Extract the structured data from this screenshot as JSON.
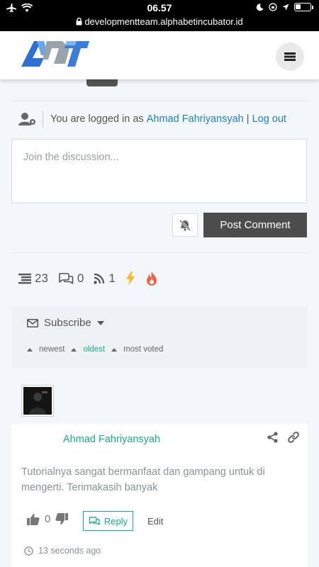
{
  "status_bar": {
    "time": "06.57",
    "url": "developmentteam.alphabetincubator.id"
  },
  "header": {
    "logo_text": "ADT",
    "menu_icon": "hamburger-icon"
  },
  "login": {
    "prefix": "You are logged in as",
    "user_name": "Ahmad Fahriyansyah",
    "separator": "|",
    "logout_label": "Log out"
  },
  "comment_form": {
    "placeholder": "Join the discussion...",
    "post_label": "Post Comment",
    "notify_icon": "bell-slash-icon"
  },
  "stats": {
    "threads": "23",
    "replies": "0",
    "followers": "1"
  },
  "subscribe": {
    "label": "Subscribe",
    "sort": [
      "newest",
      "oldest",
      "most voted"
    ],
    "active_sort": "oldest"
  },
  "comment": {
    "author": "Ahmad Fahriyansyah",
    "text": "Tutorialnya sangat bermanfaat dan gampang untuk di mengerti. Terimakasih banyak",
    "votes": "0",
    "reply_label": "Reply",
    "edit_label": "Edit",
    "time_ago": "13 seconds ago"
  },
  "colors": {
    "accent_green": "#1bab8a",
    "link_blue": "#1e7fbf",
    "button_dark": "#4c4c4c",
    "lightning": "#f5b82e",
    "fire": "#f0614a"
  }
}
